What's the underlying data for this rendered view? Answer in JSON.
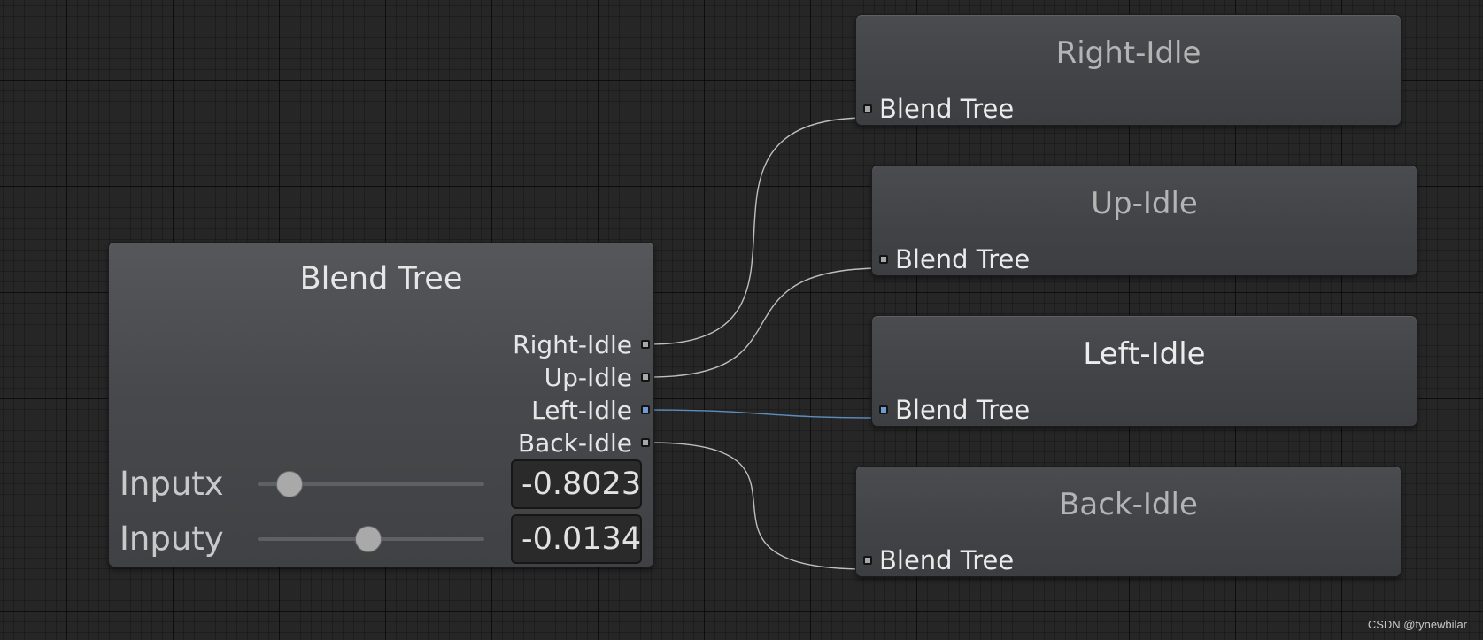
{
  "graph": {
    "connection_color": "#bfbfbf",
    "selected_connection_color": "#5d8fbd"
  },
  "blend_tree_node": {
    "title": "Blend Tree",
    "outputs": [
      {
        "label": "Right-Idle",
        "selected": false
      },
      {
        "label": "Up-Idle",
        "selected": false
      },
      {
        "label": "Left-Idle",
        "selected": true
      },
      {
        "label": "Back-Idle",
        "selected": false
      }
    ],
    "parameters": [
      {
        "label": "Inputx",
        "value": "-0.8023",
        "slider_fraction": 0.14
      },
      {
        "label": "Inputy",
        "value": "-0.0134",
        "slider_fraction": 0.49
      }
    ]
  },
  "motion_nodes": [
    {
      "title": "Right-Idle",
      "input_label": "Blend Tree"
    },
    {
      "title": "Up-Idle",
      "input_label": "Blend Tree"
    },
    {
      "title": "Left-Idle",
      "input_label": "Blend Tree"
    },
    {
      "title": "Back-Idle",
      "input_label": "Blend Tree"
    }
  ],
  "watermark": "CSDN @tynewbilar"
}
